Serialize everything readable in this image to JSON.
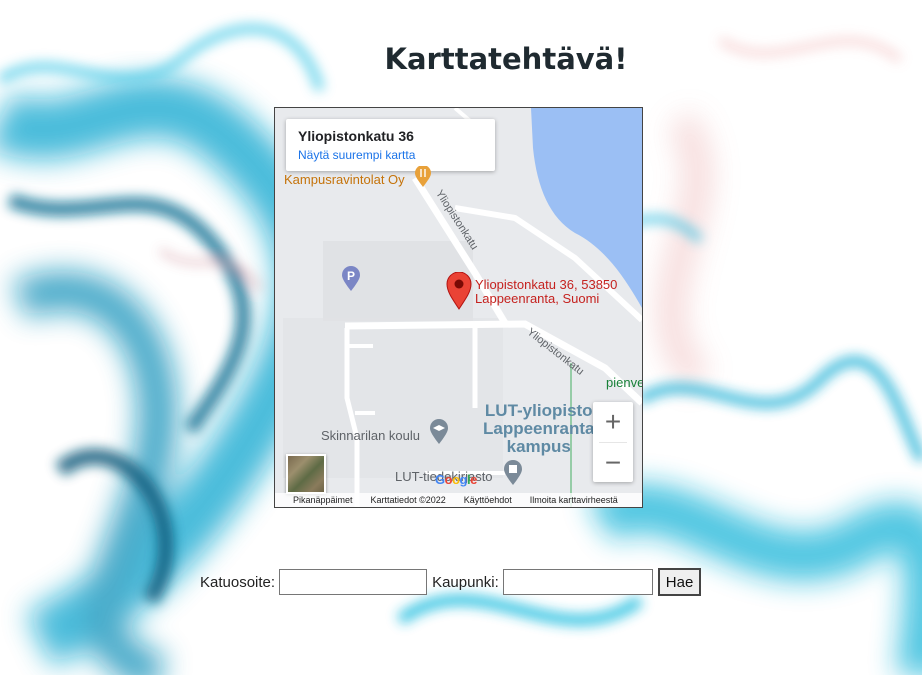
{
  "page": {
    "title": "Karttatehtävä!"
  },
  "map": {
    "place_card": {
      "name": "Yliopistonkatu 36",
      "link": "Näytä suurempi kartta"
    },
    "labels": {
      "restaurant": "Kampusravintolat Oy",
      "address_line1": "Yliopistonkatu 36, 53850",
      "address_line2": "Lappeenranta, Suomi",
      "street1": "Yliopistonkatu",
      "street2": "Yliopistonkatu",
      "school": "Skinnarilan koulu",
      "campus_line1": "LUT-yliopisto",
      "campus_line2": "Lappeenranta",
      "campus_line3": "kampus",
      "library": "LUT-tiedekirjasto",
      "park": "pienve"
    },
    "zoom": {
      "in": "+",
      "out": "−"
    },
    "google_logo": "Google",
    "attribution": {
      "shortcuts": "Pikanäppäimet",
      "map_data": "Karttatiedot ©2022",
      "terms": "Käyttöehdot",
      "report": "Ilmoita karttavirheestä"
    },
    "colors": {
      "water": "#9bbff4",
      "pin": "#ea4335",
      "parking": "#7b86c5"
    }
  },
  "form": {
    "street_label": "Katuosoite:",
    "street_value": "",
    "city_label": "Kaupunki:",
    "city_value": "",
    "submit_label": "Hae"
  }
}
